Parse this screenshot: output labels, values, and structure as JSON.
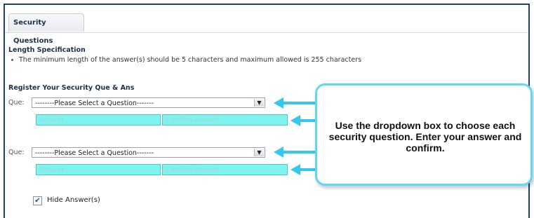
{
  "tab": {
    "label": "Security Questions"
  },
  "length_spec": {
    "title": "Length Specification",
    "text": "The minimum length of the answer(s) should be 5 characters and maximum allowed is 255 characters"
  },
  "register": {
    "title": "Register Your Security Que & Ans"
  },
  "questions": [
    {
      "label": "Que:",
      "select_value": "--------Please Select a Question-------",
      "answer_placeholder": "Answer",
      "confirm_placeholder": "Confirm Answer"
    },
    {
      "label": "Que:",
      "select_value": "--------Please Select a Question-------",
      "answer_placeholder": "Answer",
      "confirm_placeholder": "Confirm Answer"
    }
  ],
  "hide_answers": {
    "label": "Hide Answer(s)",
    "checked": true
  },
  "callout": {
    "text": "Use the dropdown box to choose each security question. Enter your answer and confirm."
  },
  "colors": {
    "frame": "#1f3f7a",
    "field_fill": "#7ff3f0",
    "arrow": "#32c8f0",
    "callout_border": "#5fd7f5"
  },
  "icons": {
    "dropdown": "chevron-down-icon",
    "checkbox": "checkmark-icon"
  }
}
